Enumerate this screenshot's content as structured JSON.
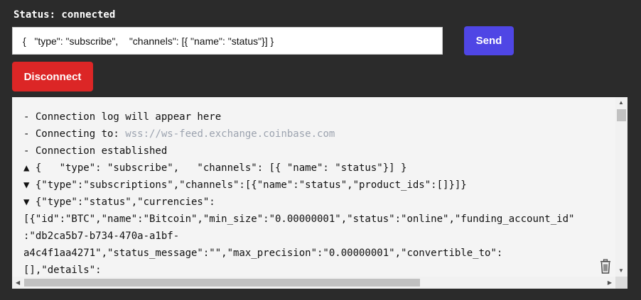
{
  "status": {
    "text": "Status: connected"
  },
  "message_input": {
    "value": "{   \"type\": \"subscribe\",    \"channels\": [{ \"name\": \"status\"}] }"
  },
  "send_button": {
    "label": "Send"
  },
  "disconnect_button": {
    "label": "Disconnect"
  },
  "log": {
    "lines": [
      {
        "text": "- Connection log will appear here"
      },
      {
        "prefix": "- Connecting to: ",
        "muted": "wss://ws-feed.exchange.coinbase.com"
      },
      {
        "text": "- Connection established"
      },
      {
        "text": "▲ {   \"type\": \"subscribe\",   \"channels\": [{ \"name\": \"status\"}] }"
      },
      {
        "text": "▼ {\"type\":\"subscriptions\",\"channels\":[{\"name\":\"status\",\"product_ids\":[]}]}"
      },
      {
        "text": "▼ {\"type\":\"status\",\"currencies\":"
      },
      {
        "text": "[{\"id\":\"BTC\",\"name\":\"Bitcoin\",\"min_size\":\"0.00000001\",\"status\":\"online\",\"funding_account_id\""
      },
      {
        "text": ":\"db2ca5b7-b734-470a-a1bf-"
      },
      {
        "text": "a4c4f1aa4271\",\"status_message\":\"\",\"max_precision\":\"0.00000001\",\"convertible_to\":"
      },
      {
        "text": "[],\"details\":"
      }
    ]
  },
  "colors": {
    "background": "#2b2b2b",
    "send": "#4f46e5",
    "disconnect": "#dc2626",
    "log_bg": "#f4f4f4",
    "muted": "#9ca3af"
  }
}
